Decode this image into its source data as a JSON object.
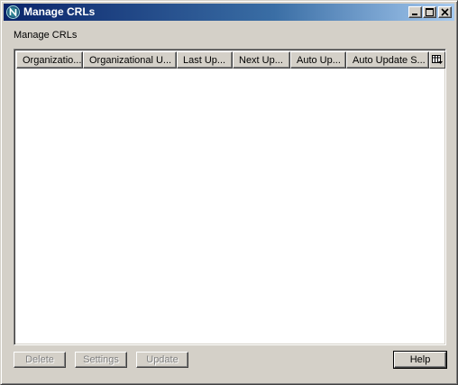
{
  "window": {
    "title": "Manage CRLs",
    "icon": "netscape-n-icon"
  },
  "caption_buttons": {
    "minimize": "minimize-icon",
    "maximize": "maximize-icon",
    "close": "close-icon"
  },
  "group": {
    "label": "Manage CRLs"
  },
  "list": {
    "columns": [
      "Organizatio...",
      "Organizational U...",
      "Last Up...",
      "Next Up...",
      "Auto Up...",
      "Auto Update S..."
    ],
    "column_picker_icon": "column-picker-icon",
    "rows": []
  },
  "buttons": {
    "delete": "Delete",
    "settings": "Settings",
    "update": "Update",
    "help": "Help"
  },
  "colors": {
    "title_start": "#0a246a",
    "title_end": "#a6caf0",
    "face": "#d4d0c8",
    "disabled_text": "#808080"
  }
}
